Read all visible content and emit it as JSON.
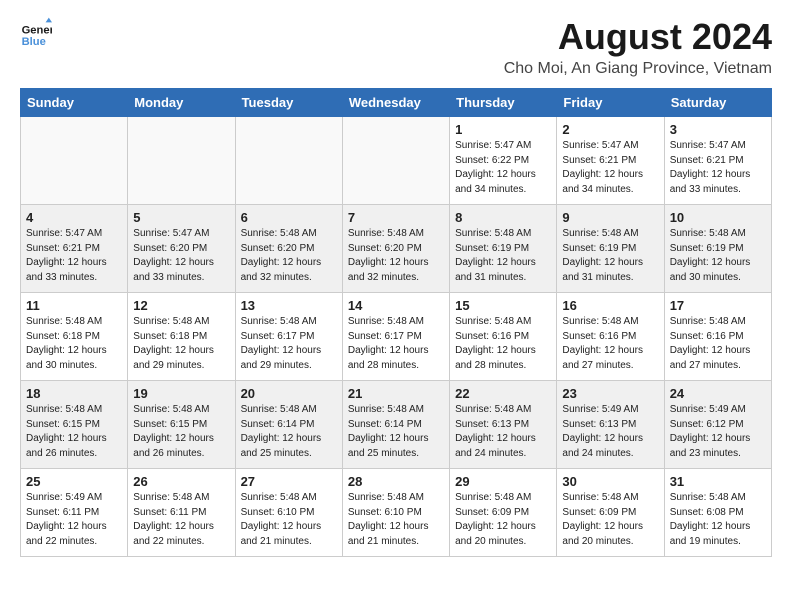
{
  "logo": {
    "line1": "General",
    "line2": "Blue"
  },
  "title": "August 2024",
  "location": "Cho Moi, An Giang Province, Vietnam",
  "days_of_week": [
    "Sunday",
    "Monday",
    "Tuesday",
    "Wednesday",
    "Thursday",
    "Friday",
    "Saturday"
  ],
  "weeks": [
    [
      {
        "day": "",
        "info": ""
      },
      {
        "day": "",
        "info": ""
      },
      {
        "day": "",
        "info": ""
      },
      {
        "day": "",
        "info": ""
      },
      {
        "day": "1",
        "info": "Sunrise: 5:47 AM\nSunset: 6:22 PM\nDaylight: 12 hours\nand 34 minutes."
      },
      {
        "day": "2",
        "info": "Sunrise: 5:47 AM\nSunset: 6:21 PM\nDaylight: 12 hours\nand 34 minutes."
      },
      {
        "day": "3",
        "info": "Sunrise: 5:47 AM\nSunset: 6:21 PM\nDaylight: 12 hours\nand 33 minutes."
      }
    ],
    [
      {
        "day": "4",
        "info": "Sunrise: 5:47 AM\nSunset: 6:21 PM\nDaylight: 12 hours\nand 33 minutes."
      },
      {
        "day": "5",
        "info": "Sunrise: 5:47 AM\nSunset: 6:20 PM\nDaylight: 12 hours\nand 33 minutes."
      },
      {
        "day": "6",
        "info": "Sunrise: 5:48 AM\nSunset: 6:20 PM\nDaylight: 12 hours\nand 32 minutes."
      },
      {
        "day": "7",
        "info": "Sunrise: 5:48 AM\nSunset: 6:20 PM\nDaylight: 12 hours\nand 32 minutes."
      },
      {
        "day": "8",
        "info": "Sunrise: 5:48 AM\nSunset: 6:19 PM\nDaylight: 12 hours\nand 31 minutes."
      },
      {
        "day": "9",
        "info": "Sunrise: 5:48 AM\nSunset: 6:19 PM\nDaylight: 12 hours\nand 31 minutes."
      },
      {
        "day": "10",
        "info": "Sunrise: 5:48 AM\nSunset: 6:19 PM\nDaylight: 12 hours\nand 30 minutes."
      }
    ],
    [
      {
        "day": "11",
        "info": "Sunrise: 5:48 AM\nSunset: 6:18 PM\nDaylight: 12 hours\nand 30 minutes."
      },
      {
        "day": "12",
        "info": "Sunrise: 5:48 AM\nSunset: 6:18 PM\nDaylight: 12 hours\nand 29 minutes."
      },
      {
        "day": "13",
        "info": "Sunrise: 5:48 AM\nSunset: 6:17 PM\nDaylight: 12 hours\nand 29 minutes."
      },
      {
        "day": "14",
        "info": "Sunrise: 5:48 AM\nSunset: 6:17 PM\nDaylight: 12 hours\nand 28 minutes."
      },
      {
        "day": "15",
        "info": "Sunrise: 5:48 AM\nSunset: 6:16 PM\nDaylight: 12 hours\nand 28 minutes."
      },
      {
        "day": "16",
        "info": "Sunrise: 5:48 AM\nSunset: 6:16 PM\nDaylight: 12 hours\nand 27 minutes."
      },
      {
        "day": "17",
        "info": "Sunrise: 5:48 AM\nSunset: 6:16 PM\nDaylight: 12 hours\nand 27 minutes."
      }
    ],
    [
      {
        "day": "18",
        "info": "Sunrise: 5:48 AM\nSunset: 6:15 PM\nDaylight: 12 hours\nand 26 minutes."
      },
      {
        "day": "19",
        "info": "Sunrise: 5:48 AM\nSunset: 6:15 PM\nDaylight: 12 hours\nand 26 minutes."
      },
      {
        "day": "20",
        "info": "Sunrise: 5:48 AM\nSunset: 6:14 PM\nDaylight: 12 hours\nand 25 minutes."
      },
      {
        "day": "21",
        "info": "Sunrise: 5:48 AM\nSunset: 6:14 PM\nDaylight: 12 hours\nand 25 minutes."
      },
      {
        "day": "22",
        "info": "Sunrise: 5:48 AM\nSunset: 6:13 PM\nDaylight: 12 hours\nand 24 minutes."
      },
      {
        "day": "23",
        "info": "Sunrise: 5:49 AM\nSunset: 6:13 PM\nDaylight: 12 hours\nand 24 minutes."
      },
      {
        "day": "24",
        "info": "Sunrise: 5:49 AM\nSunset: 6:12 PM\nDaylight: 12 hours\nand 23 minutes."
      }
    ],
    [
      {
        "day": "25",
        "info": "Sunrise: 5:49 AM\nSunset: 6:11 PM\nDaylight: 12 hours\nand 22 minutes."
      },
      {
        "day": "26",
        "info": "Sunrise: 5:48 AM\nSunset: 6:11 PM\nDaylight: 12 hours\nand 22 minutes."
      },
      {
        "day": "27",
        "info": "Sunrise: 5:48 AM\nSunset: 6:10 PM\nDaylight: 12 hours\nand 21 minutes."
      },
      {
        "day": "28",
        "info": "Sunrise: 5:48 AM\nSunset: 6:10 PM\nDaylight: 12 hours\nand 21 minutes."
      },
      {
        "day": "29",
        "info": "Sunrise: 5:48 AM\nSunset: 6:09 PM\nDaylight: 12 hours\nand 20 minutes."
      },
      {
        "day": "30",
        "info": "Sunrise: 5:48 AM\nSunset: 6:09 PM\nDaylight: 12 hours\nand 20 minutes."
      },
      {
        "day": "31",
        "info": "Sunrise: 5:48 AM\nSunset: 6:08 PM\nDaylight: 12 hours\nand 19 minutes."
      }
    ]
  ]
}
